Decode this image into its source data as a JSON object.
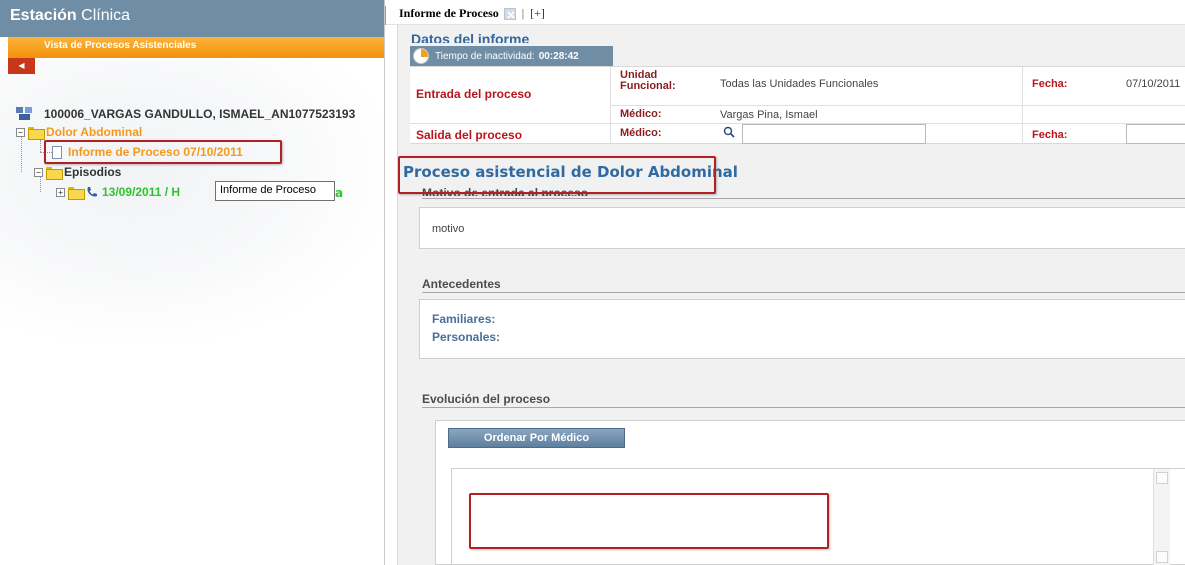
{
  "app": {
    "title_bold": "Estación",
    "title_rest": " Clínica",
    "subtitle": "Vista de Procesos Asistenciales"
  },
  "tree": {
    "patient": "100006_VARGAS GANDULLO, ISMAEL_AN1077523193",
    "process": "Dolor Abdominal",
    "report": "Informe de Proceso 07/10/2011",
    "episodes_folder": "Episodios",
    "episode": "13/09/2011 / H",
    "episode_tail": "a"
  },
  "tooltip": "Informe de Proceso",
  "tabs": {
    "active": "Informe de Proceso",
    "separator": "|",
    "add": "[+]"
  },
  "report": {
    "section_title": "Datos del informe",
    "inactivity_label": "Tiempo de inactividad:",
    "inactivity_time": "00:28:42",
    "entrada_label": "Entrada del proceso",
    "salida_label": "Salida del proceso",
    "unidad_label": "Unidad Funcional:",
    "unidad_value": "Todas las Unidades Funcionales",
    "medico_label": "Médico:",
    "medico_value": "Vargas Pina, Ismael",
    "medico_label_2": "Médico:",
    "fecha_label": "Fecha:",
    "fecha_value": "07/10/2011",
    "fecha_label_2": "Fecha:"
  },
  "proceso": {
    "title": "Proceso asistencial de Dolor Abdominal",
    "motivo_title": "Motivo de entrada al proceso",
    "motivo_value": "motivo",
    "antecedentes_title": "Antecedentes",
    "familiares_label": "Familiares:",
    "personales_label": "Personales:",
    "evolucion_title": "Evolución del proceso",
    "ordenar_button": "Ordenar Por Médico"
  },
  "colors": {
    "header_blue": "#6f8ea6",
    "orange": "#f39a1d",
    "red_label": "#b9151b",
    "green_episode": "#2cc52c",
    "highlight_red": "#b32024"
  }
}
